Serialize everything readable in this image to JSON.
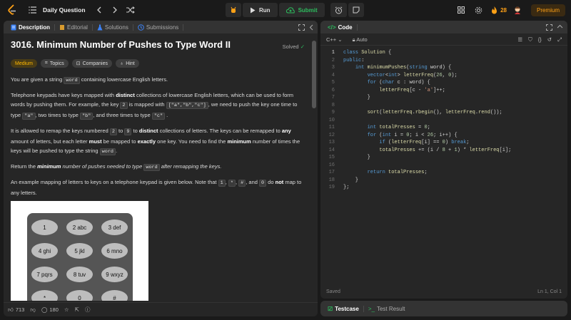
{
  "nav": {
    "title": "Daily Question",
    "run_label": "Run",
    "submit_label": "Submit",
    "streak": "28",
    "premium_label": "Premium",
    "accent": "#ffa116",
    "submit_color": "#2cbb5d"
  },
  "left_tabs": [
    {
      "label": "Description",
      "icon": "description-icon"
    },
    {
      "label": "Editorial",
      "icon": "book-icon"
    },
    {
      "label": "Solutions",
      "icon": "flask-icon"
    },
    {
      "label": "Submissions",
      "icon": "history-icon"
    }
  ],
  "problem": {
    "title": "3016. Minimum Number of Pushes to Type Word II",
    "status": "Solved",
    "tags": [
      "Medium",
      "Topics",
      "Companies",
      "Hint"
    ]
  },
  "desc": {
    "p1_a": "You are given a string ",
    "p1_code": "word",
    "p1_b": " containing lowercase English letters.",
    "p2_a": "Telephone keypads have keys mapped with ",
    "p2_b1": "distinct",
    "p2_c": " collections of lowercase English letters, which can be used to form words by pushing them. For example, the key ",
    "p2_code1": "2",
    "p2_d": " is mapped with ",
    "p2_code2": "[\"a\",\"b\",\"c\"]",
    "p2_e": ", we need to push the key one time to type ",
    "p2_code3": "\"a\"",
    "p2_f": ", two times to type ",
    "p2_code4": "\"b\"",
    "p2_g": ", and three times to type ",
    "p2_code5": "\"c\"",
    "p2_h": " .",
    "p3_a": "It is allowed to remap the keys numbered ",
    "p3_code1": "2",
    "p3_b": " to ",
    "p3_code2": "9",
    "p3_c": " to ",
    "p3_b1": "distinct",
    "p3_d": " collections of letters. The keys can be remapped to ",
    "p3_b2": "any",
    "p3_e": " amount of letters, but each letter ",
    "p3_b3": "must",
    "p3_f": " be mapped to ",
    "p3_b4": "exactly",
    "p3_g": " one key. You need to find the ",
    "p3_b5": "minimum",
    "p3_h": " number of times the keys will be pushed to type the string ",
    "p3_code3": "word",
    "p3_i": ".",
    "p4_a": "Return the ",
    "p4_b": "minimum",
    "p4_c": " number of pushes needed to type ",
    "p4_code": "word",
    "p4_d": " after remapping the keys.",
    "p5_a": "An example mapping of letters to keys on a telephone keypad is given below. Note that ",
    "p5_code1": "1",
    "p5_b": ", ",
    "p5_code2": "*",
    "p5_c": ", ",
    "p5_code3": "#",
    "p5_d": ", and ",
    "p5_code4": "0",
    "p5_e": " do ",
    "p5_b1": "not",
    "p5_f": " map to any letters."
  },
  "keypad": [
    "1",
    "2 abc",
    "3 def",
    "4 ghi",
    "5 jkl",
    "6 mno",
    "7 pqrs",
    "8 tuv",
    "9 wxyz",
    "*",
    "0",
    "#"
  ],
  "footer": {
    "likes": "713",
    "comments": "180"
  },
  "code_panel": {
    "tab_label": "Code",
    "language": "C++",
    "auto_label": "Auto",
    "status": "Saved",
    "cursor": "Ln 1, Col 1"
  },
  "code_lines": [
    "class Solution {",
    "public:",
    "    int minimumPushes(string word) {",
    "        vector<int> letterFreq(26, 0);",
    "        for (char c : word) {",
    "            letterFreq[c - 'a']++;",
    "        }",
    "",
    "        sort(letterFreq.rbegin(), letterFreq.rend());",
    "",
    "        int totalPresses = 0;",
    "        for (int i = 0; i < 26; i++) {",
    "            if (letterFreq[i] == 0) break;",
    "            totalPresses += (i / 8 + 1) * letterFreq[i];",
    "        }",
    "",
    "        return totalPresses;",
    "    }",
    "};"
  ],
  "bottom_tabs": {
    "testcase": "Testcase",
    "result": "Test Result"
  }
}
